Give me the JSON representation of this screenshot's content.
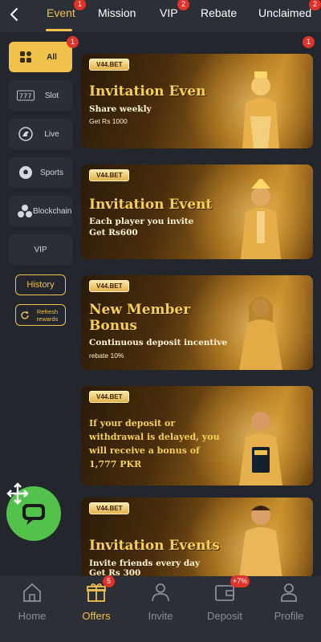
{
  "top_tabs": [
    {
      "label": "Event",
      "badge": "1",
      "active": true
    },
    {
      "label": "Mission"
    },
    {
      "label": "VIP",
      "badge": "2"
    },
    {
      "label": "Rebate"
    },
    {
      "label": "Unclaimed",
      "badge": "2"
    }
  ],
  "sidebar": {
    "items": [
      {
        "label": "All",
        "icon": "grid-icon",
        "active": true,
        "badge": "1"
      },
      {
        "label": "Slot",
        "icon": "slot-machine-icon"
      },
      {
        "label": "Live",
        "icon": "live-dealer-icon"
      },
      {
        "label": "Sports",
        "icon": "soccer-ball-icon"
      },
      {
        "label": "Blockchain",
        "icon": "blockchain-icon"
      },
      {
        "label": "VIP"
      }
    ],
    "history_label": "History",
    "refresh_label": "Refresh rewards"
  },
  "content_badge": "1",
  "banners": [
    {
      "brand": "V44.BET",
      "title": "Invitation Even",
      "sub": "Share weekly",
      "sub2": "Get Rs 1000"
    },
    {
      "brand": "V44.BET",
      "title": "Invitation Event",
      "sub": "Each player you invite",
      "sub2": "Get Rs600"
    },
    {
      "brand": "V44.BET",
      "title_line1": "New Member",
      "title_line2": "Bonus",
      "sub": "Continuous deposit incentive",
      "sub2": "rebate 10%"
    },
    {
      "brand": "V44.BET",
      "body": "If your deposit or withdrawal is delayed, you will receive a bonus of 1,777 PKR"
    },
    {
      "brand": "V44.BET",
      "title": "Invitation Events",
      "sub": "Invite friends every day",
      "sub2": "Get Rs 300"
    }
  ],
  "bottom_nav": [
    {
      "label": "Home",
      "icon": "home-icon"
    },
    {
      "label": "Offers",
      "icon": "gift-icon",
      "badge": "5",
      "active": true
    },
    {
      "label": "Invite",
      "icon": "invite-icon"
    },
    {
      "label": "Deposit",
      "icon": "wallet-icon",
      "badge": "+7%"
    },
    {
      "label": "Profile",
      "icon": "profile-icon"
    }
  ],
  "colors": {
    "accent": "#f0c24b",
    "background": "#23262d",
    "badge": "#e0342b",
    "chat": "#52c24a"
  }
}
